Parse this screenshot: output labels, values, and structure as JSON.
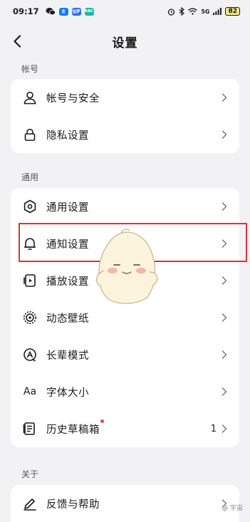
{
  "status_bar": {
    "time": "09:17",
    "network": "5G",
    "battery": "82",
    "app_icons": [
      {
        "name": "wechat-icon",
        "color": "#07c160",
        "text": ""
      },
      {
        "name": "alipay-icon",
        "color": "#1677ff",
        "text": "支"
      },
      {
        "name": "app-icon-blue",
        "color": "#2a6ef0",
        "text": "拉萨"
      },
      {
        "name": "app-icon-teal",
        "color": "#20b2aa",
        "text": "BBC"
      }
    ]
  },
  "nav": {
    "title": "设置"
  },
  "sections": {
    "account": {
      "label": "帐号",
      "items": [
        {
          "label": "帐号与安全",
          "icon": "user-icon"
        },
        {
          "label": "隐私设置",
          "icon": "lock-icon"
        }
      ]
    },
    "general": {
      "label": "通用",
      "items": [
        {
          "label": "通用设置",
          "icon": "gear-icon"
        },
        {
          "label": "通知设置",
          "icon": "bell-icon"
        },
        {
          "label": "播放设置",
          "icon": "play-settings-icon"
        },
        {
          "label": "动态壁纸",
          "icon": "wallpaper-icon"
        },
        {
          "label": "长辈模式",
          "icon": "elder-mode-icon"
        },
        {
          "label": "字体大小",
          "icon": "font-size-icon"
        },
        {
          "label": "历史草稿箱",
          "icon": "drafts-icon",
          "value": "1",
          "has_dot": true
        }
      ]
    },
    "about": {
      "label": "关于",
      "items": [
        {
          "label": "反馈与帮助",
          "icon": "feedback-icon"
        }
      ]
    }
  },
  "font_size_glyph": "Aa",
  "watermark": "@ 宇宙",
  "colors": {
    "background": "#f2f2f4",
    "card": "#ffffff",
    "highlight": "#d9343a",
    "dot": "#e94b3c"
  }
}
